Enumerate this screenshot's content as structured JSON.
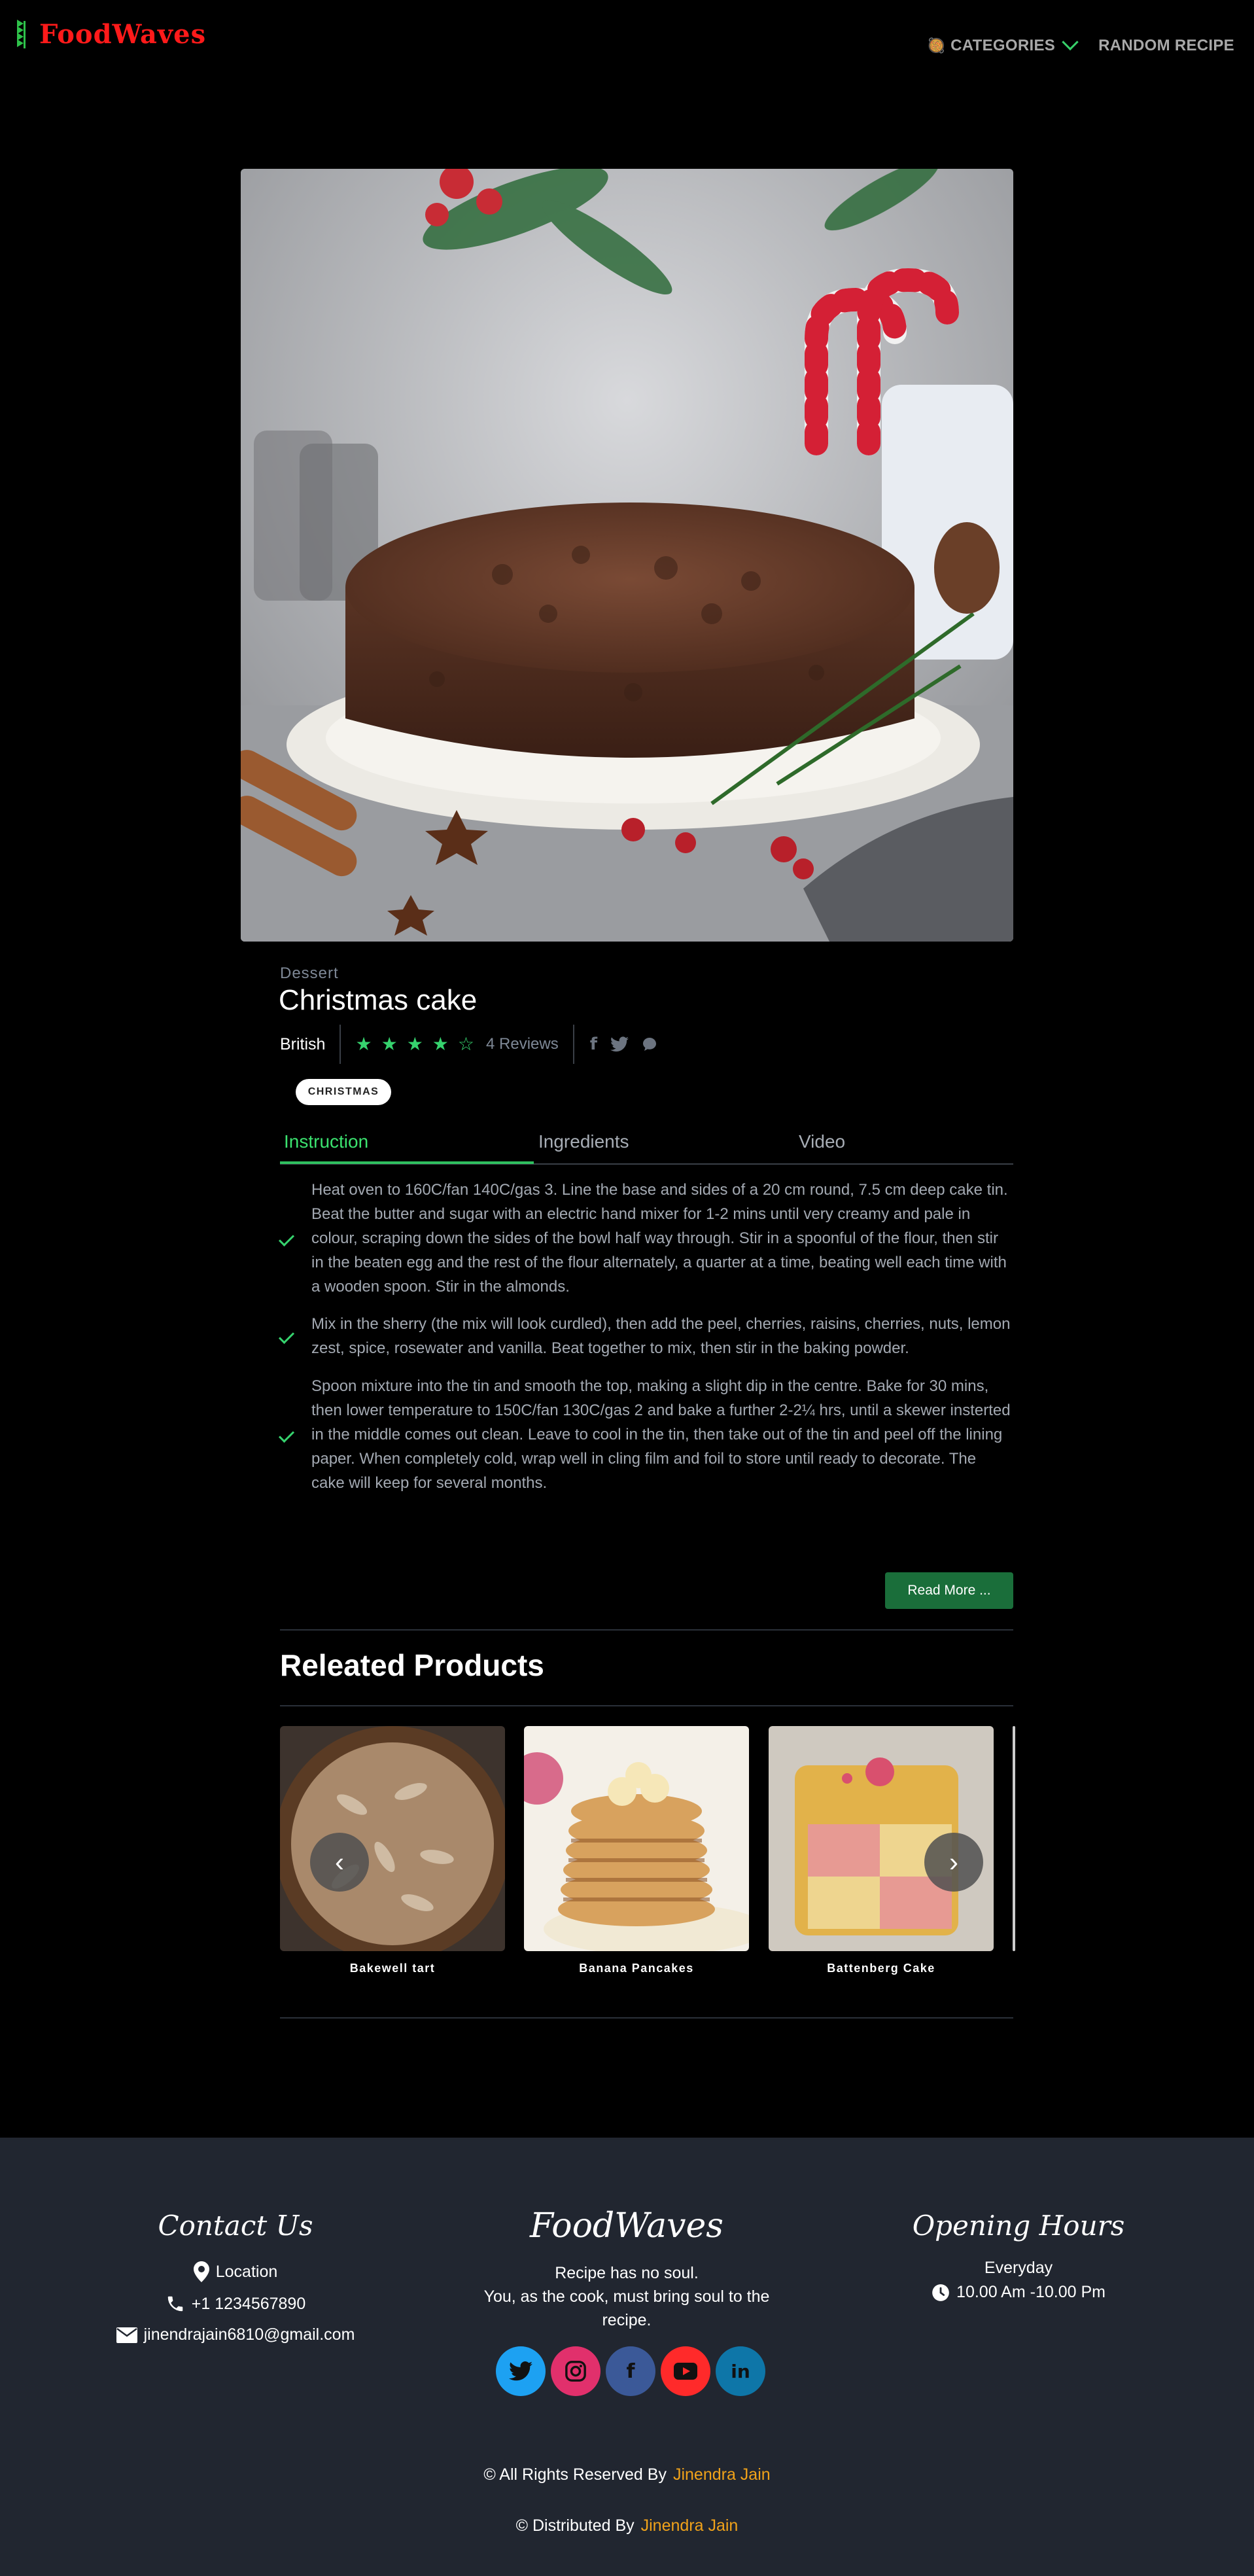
{
  "nav": {
    "logo": "FoodWaves",
    "categories_label": "CATEGORIES",
    "random_label": "RANDOM RECIPE"
  },
  "recipe": {
    "category": "Dessert",
    "title": "Christmas cake",
    "cuisine": "British",
    "rating": 4,
    "rating_max": 5,
    "reviews": "4 Reviews",
    "tag": "CHRISTMAS",
    "tabs": [
      "Instruction",
      "Ingredients",
      "Video"
    ],
    "active_tab": "Instruction",
    "steps": [
      "Heat oven to 160C/fan 140C/gas 3. Line the base and sides of a 20 cm round, 7.5 cm deep cake tin. Beat the butter and sugar with an electric hand mixer for 1-2 mins until very creamy and pale in colour, scraping down the sides of the bowl half way through. Stir in a spoonful of the flour, then stir in the beaten egg and the rest of the flour alternately, a quarter at a time, beating well each time with a wooden spoon. Stir in the almonds.",
      "Mix in the sherry (the mix will look curdled), then add the peel, cherries, raisins, cherries, nuts, lemon zest, spice, rosewater and vanilla. Beat together to mix, then stir in the baking powder.",
      "Spoon mixture into the tin and smooth the top, making a slight dip in the centre. Bake for 30 mins, then lower temperature to 150C/fan 130C/gas 2 and bake a further 2-2¼ hrs, until a skewer insterted in the middle comes out clean. Leave to cool in the tin, then take out of the tin and peel off the lining paper. When completely cold, wrap well in cling film and foil to store until ready to decorate. The cake will keep for several months."
    ],
    "read_more": "Read More ..."
  },
  "related": {
    "title": "Releated Products",
    "items": [
      {
        "name": "Bakewell tart"
      },
      {
        "name": "Banana Pancakes"
      },
      {
        "name": "Battenberg Cake"
      }
    ]
  },
  "footer": {
    "contact": {
      "title": "Contact Us",
      "location": "Location",
      "phone": "+1 1234567890",
      "email": "jinendrajain6810@gmail.com"
    },
    "brand": {
      "title": "FoodWaves",
      "line1": "Recipe has no soul.",
      "line2": "You, as the cook, must bring soul to the",
      "line3": "recipe."
    },
    "hours": {
      "title": "Opening Hours",
      "days": "Everyday",
      "time": "10.00 Am -10.00 Pm"
    },
    "socials": [
      {
        "name": "twitter",
        "color": "#1da1f2"
      },
      {
        "name": "instagram",
        "color": "#e1306c"
      },
      {
        "name": "facebook",
        "color": "#3b5998"
      },
      {
        "name": "youtube",
        "color": "#ff2a2a"
      },
      {
        "name": "linkedin",
        "color": "#0e76a8"
      }
    ],
    "rights_text": "© All Rights Reserved By",
    "rights_author": "Jinendra Jain",
    "distributed_text": "© Distributed By",
    "distributed_author": "Jinendra Jain"
  },
  "colors": {
    "accent": "#36d36e",
    "logo": "#ff1a1a",
    "footer_bg": "#212630",
    "button": "#1a6e3a",
    "author": "#f0a21a"
  }
}
